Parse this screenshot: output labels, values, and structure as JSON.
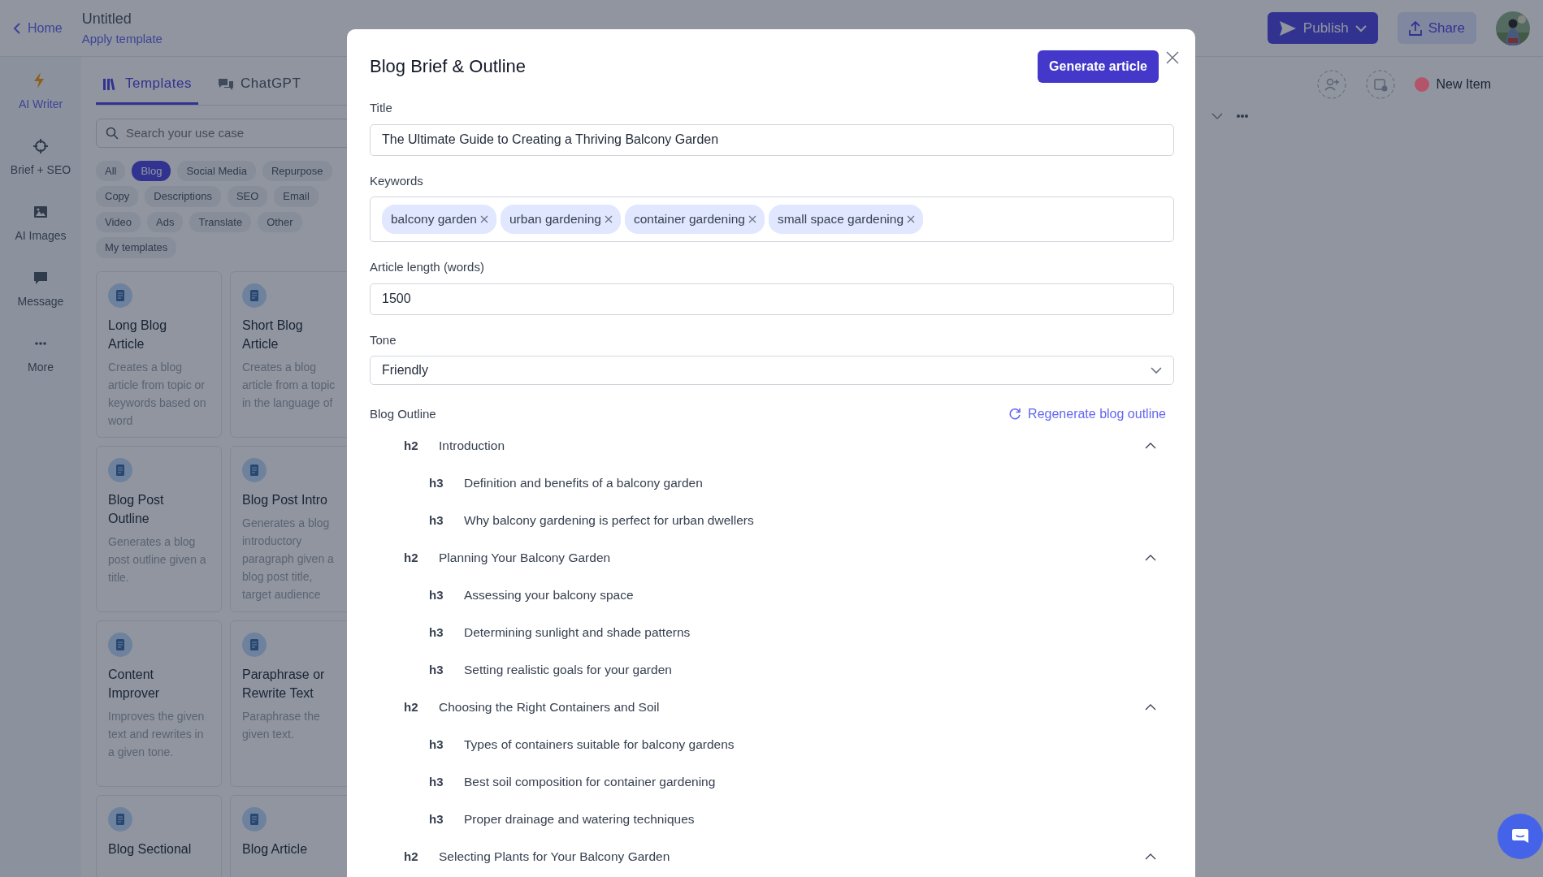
{
  "header": {
    "back_link": "Home",
    "title": "Untitled",
    "subtitle_link": "Apply template",
    "publish_button": "Publish",
    "share_button": "Share"
  },
  "sidebar": {
    "items": [
      {
        "label": "AI Writer",
        "selected": true
      },
      {
        "label": "Brief + SEO",
        "selected": false
      },
      {
        "label": "AI Images",
        "selected": false
      },
      {
        "label": "Message",
        "selected": false
      },
      {
        "label": "More",
        "selected": false
      }
    ]
  },
  "templates_panel": {
    "tabs": [
      {
        "label": "Templates",
        "selected": true
      },
      {
        "label": "ChatGPT",
        "selected": false
      }
    ],
    "search": {
      "placeholder": "Search your use case"
    },
    "filters": [
      {
        "label": "All",
        "selected": false
      },
      {
        "label": "Blog",
        "selected": true
      },
      {
        "label": "Social Media",
        "selected": false
      },
      {
        "label": "Repurpose",
        "selected": false
      },
      {
        "label": "Copy",
        "selected": false
      },
      {
        "label": "Descriptions",
        "selected": false
      },
      {
        "label": "SEO",
        "selected": false
      },
      {
        "label": "Email",
        "selected": false
      },
      {
        "label": "Video",
        "selected": false
      },
      {
        "label": "Ads",
        "selected": false
      },
      {
        "label": "Translate",
        "selected": false
      },
      {
        "label": "Other",
        "selected": false
      },
      {
        "label": "My templates",
        "selected": false
      }
    ],
    "cards": [
      {
        "title": "Long Blog Article",
        "description": "Creates a blog article from topic or keywords based on word"
      },
      {
        "title": "Short Blog Article",
        "description": "Creates a blog article from a topic in the language of"
      },
      {
        "title": "Blog Post Outline",
        "description": "Generates a blog post outline given a title."
      },
      {
        "title": "Blog Post Intro",
        "description": "Generates a blog introductory paragraph given a blog post title, target audience"
      },
      {
        "title": "Content Improver",
        "description": "Improves the given text and rewrites in a given tone."
      },
      {
        "title": "Paraphrase or Rewrite Text",
        "description": "Paraphrase the given text."
      },
      {
        "title": "Blog Sectional"
      },
      {
        "title": "Blog Article"
      }
    ]
  },
  "item_bar": {
    "name": "New Item",
    "color": "#b4546a"
  },
  "modal": {
    "title": "Blog Brief & Outline",
    "generate_button": "Generate article",
    "title_field": {
      "label": "Title",
      "value": "The Ultimate Guide to Creating a Thriving Balcony Garden"
    },
    "keywords_field": {
      "label": "Keywords",
      "tags": [
        "balcony garden",
        "urban gardening",
        "container gardening",
        "small space gardening"
      ]
    },
    "length_field": {
      "label": "Article length (words)",
      "value": "1500"
    },
    "tone_field": {
      "label": "Tone",
      "value": "Friendly"
    },
    "outline": {
      "label": "Blog Outline",
      "regenerate_link": "Regenerate blog outline",
      "items": [
        {
          "tag": "h2",
          "text": "Introduction",
          "expanded": true,
          "children": [
            {
              "tag": "h3",
              "text": "Definition and benefits of a balcony garden"
            },
            {
              "tag": "h3",
              "text": "Why balcony gardening is perfect for urban dwellers"
            }
          ]
        },
        {
          "tag": "h2",
          "text": "Planning Your Balcony Garden",
          "expanded": true,
          "children": [
            {
              "tag": "h3",
              "text": "Assessing your balcony space"
            },
            {
              "tag": "h3",
              "text": "Determining sunlight and shade patterns"
            },
            {
              "tag": "h3",
              "text": "Setting realistic goals for your garden"
            }
          ]
        },
        {
          "tag": "h2",
          "text": "Choosing the Right Containers and Soil",
          "expanded": true,
          "children": [
            {
              "tag": "h3",
              "text": "Types of containers suitable for balcony gardens"
            },
            {
              "tag": "h3",
              "text": "Best soil composition for container gardening"
            },
            {
              "tag": "h3",
              "text": "Proper drainage and watering techniques"
            }
          ]
        },
        {
          "tag": "h2",
          "text": "Selecting Plants for Your Balcony Garden",
          "expanded": true
        }
      ]
    }
  }
}
